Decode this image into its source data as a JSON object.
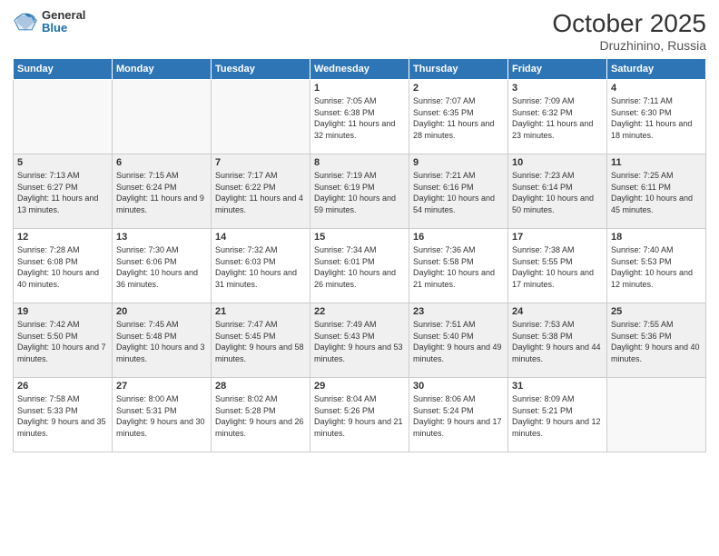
{
  "logo": {
    "general": "General",
    "blue": "Blue"
  },
  "header": {
    "month": "October 2025",
    "location": "Druzhinino, Russia"
  },
  "weekdays": [
    "Sunday",
    "Monday",
    "Tuesday",
    "Wednesday",
    "Thursday",
    "Friday",
    "Saturday"
  ],
  "weeks": [
    [
      {
        "day": "",
        "sunrise": "",
        "sunset": "",
        "daylight": "",
        "empty": true
      },
      {
        "day": "",
        "sunrise": "",
        "sunset": "",
        "daylight": "",
        "empty": true
      },
      {
        "day": "",
        "sunrise": "",
        "sunset": "",
        "daylight": "",
        "empty": true
      },
      {
        "day": "1",
        "sunrise": "Sunrise: 7:05 AM",
        "sunset": "Sunset: 6:38 PM",
        "daylight": "Daylight: 11 hours and 32 minutes."
      },
      {
        "day": "2",
        "sunrise": "Sunrise: 7:07 AM",
        "sunset": "Sunset: 6:35 PM",
        "daylight": "Daylight: 11 hours and 28 minutes."
      },
      {
        "day": "3",
        "sunrise": "Sunrise: 7:09 AM",
        "sunset": "Sunset: 6:32 PM",
        "daylight": "Daylight: 11 hours and 23 minutes."
      },
      {
        "day": "4",
        "sunrise": "Sunrise: 7:11 AM",
        "sunset": "Sunset: 6:30 PM",
        "daylight": "Daylight: 11 hours and 18 minutes."
      }
    ],
    [
      {
        "day": "5",
        "sunrise": "Sunrise: 7:13 AM",
        "sunset": "Sunset: 6:27 PM",
        "daylight": "Daylight: 11 hours and 13 minutes."
      },
      {
        "day": "6",
        "sunrise": "Sunrise: 7:15 AM",
        "sunset": "Sunset: 6:24 PM",
        "daylight": "Daylight: 11 hours and 9 minutes."
      },
      {
        "day": "7",
        "sunrise": "Sunrise: 7:17 AM",
        "sunset": "Sunset: 6:22 PM",
        "daylight": "Daylight: 11 hours and 4 minutes."
      },
      {
        "day": "8",
        "sunrise": "Sunrise: 7:19 AM",
        "sunset": "Sunset: 6:19 PM",
        "daylight": "Daylight: 10 hours and 59 minutes."
      },
      {
        "day": "9",
        "sunrise": "Sunrise: 7:21 AM",
        "sunset": "Sunset: 6:16 PM",
        "daylight": "Daylight: 10 hours and 54 minutes."
      },
      {
        "day": "10",
        "sunrise": "Sunrise: 7:23 AM",
        "sunset": "Sunset: 6:14 PM",
        "daylight": "Daylight: 10 hours and 50 minutes."
      },
      {
        "day": "11",
        "sunrise": "Sunrise: 7:25 AM",
        "sunset": "Sunset: 6:11 PM",
        "daylight": "Daylight: 10 hours and 45 minutes."
      }
    ],
    [
      {
        "day": "12",
        "sunrise": "Sunrise: 7:28 AM",
        "sunset": "Sunset: 6:08 PM",
        "daylight": "Daylight: 10 hours and 40 minutes."
      },
      {
        "day": "13",
        "sunrise": "Sunrise: 7:30 AM",
        "sunset": "Sunset: 6:06 PM",
        "daylight": "Daylight: 10 hours and 36 minutes."
      },
      {
        "day": "14",
        "sunrise": "Sunrise: 7:32 AM",
        "sunset": "Sunset: 6:03 PM",
        "daylight": "Daylight: 10 hours and 31 minutes."
      },
      {
        "day": "15",
        "sunrise": "Sunrise: 7:34 AM",
        "sunset": "Sunset: 6:01 PM",
        "daylight": "Daylight: 10 hours and 26 minutes."
      },
      {
        "day": "16",
        "sunrise": "Sunrise: 7:36 AM",
        "sunset": "Sunset: 5:58 PM",
        "daylight": "Daylight: 10 hours and 21 minutes."
      },
      {
        "day": "17",
        "sunrise": "Sunrise: 7:38 AM",
        "sunset": "Sunset: 5:55 PM",
        "daylight": "Daylight: 10 hours and 17 minutes."
      },
      {
        "day": "18",
        "sunrise": "Sunrise: 7:40 AM",
        "sunset": "Sunset: 5:53 PM",
        "daylight": "Daylight: 10 hours and 12 minutes."
      }
    ],
    [
      {
        "day": "19",
        "sunrise": "Sunrise: 7:42 AM",
        "sunset": "Sunset: 5:50 PM",
        "daylight": "Daylight: 10 hours and 7 minutes."
      },
      {
        "day": "20",
        "sunrise": "Sunrise: 7:45 AM",
        "sunset": "Sunset: 5:48 PM",
        "daylight": "Daylight: 10 hours and 3 minutes."
      },
      {
        "day": "21",
        "sunrise": "Sunrise: 7:47 AM",
        "sunset": "Sunset: 5:45 PM",
        "daylight": "Daylight: 9 hours and 58 minutes."
      },
      {
        "day": "22",
        "sunrise": "Sunrise: 7:49 AM",
        "sunset": "Sunset: 5:43 PM",
        "daylight": "Daylight: 9 hours and 53 minutes."
      },
      {
        "day": "23",
        "sunrise": "Sunrise: 7:51 AM",
        "sunset": "Sunset: 5:40 PM",
        "daylight": "Daylight: 9 hours and 49 minutes."
      },
      {
        "day": "24",
        "sunrise": "Sunrise: 7:53 AM",
        "sunset": "Sunset: 5:38 PM",
        "daylight": "Daylight: 9 hours and 44 minutes."
      },
      {
        "day": "25",
        "sunrise": "Sunrise: 7:55 AM",
        "sunset": "Sunset: 5:36 PM",
        "daylight": "Daylight: 9 hours and 40 minutes."
      }
    ],
    [
      {
        "day": "26",
        "sunrise": "Sunrise: 7:58 AM",
        "sunset": "Sunset: 5:33 PM",
        "daylight": "Daylight: 9 hours and 35 minutes."
      },
      {
        "day": "27",
        "sunrise": "Sunrise: 8:00 AM",
        "sunset": "Sunset: 5:31 PM",
        "daylight": "Daylight: 9 hours and 30 minutes."
      },
      {
        "day": "28",
        "sunrise": "Sunrise: 8:02 AM",
        "sunset": "Sunset: 5:28 PM",
        "daylight": "Daylight: 9 hours and 26 minutes."
      },
      {
        "day": "29",
        "sunrise": "Sunrise: 8:04 AM",
        "sunset": "Sunset: 5:26 PM",
        "daylight": "Daylight: 9 hours and 21 minutes."
      },
      {
        "day": "30",
        "sunrise": "Sunrise: 8:06 AM",
        "sunset": "Sunset: 5:24 PM",
        "daylight": "Daylight: 9 hours and 17 minutes."
      },
      {
        "day": "31",
        "sunrise": "Sunrise: 8:09 AM",
        "sunset": "Sunset: 5:21 PM",
        "daylight": "Daylight: 9 hours and 12 minutes."
      },
      {
        "day": "",
        "sunrise": "",
        "sunset": "",
        "daylight": "",
        "empty": true
      }
    ]
  ]
}
